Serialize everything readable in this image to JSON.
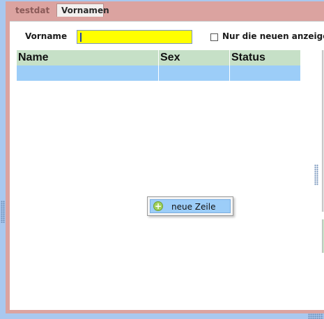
{
  "tabs": [
    {
      "label": "testdat",
      "active": false
    },
    {
      "label": "Vornamen",
      "active": true
    }
  ],
  "filter": {
    "vorname_label": "Vorname",
    "vorname_value": "",
    "checkbox_label": "Nur die neuen anzeigen",
    "checkbox_checked": false
  },
  "grid": {
    "columns": [
      "Name",
      "Sex",
      "Status"
    ],
    "rows": [
      [
        "",
        "",
        ""
      ]
    ]
  },
  "context_menu": {
    "items": [
      {
        "label": "neue Zeile",
        "icon": "add-icon"
      }
    ]
  },
  "colors": {
    "tabbar": "#dba3a0",
    "input_bg": "#ffff00",
    "header_bg": "#c6e0c7",
    "selected_row": "#9ccdf8"
  }
}
